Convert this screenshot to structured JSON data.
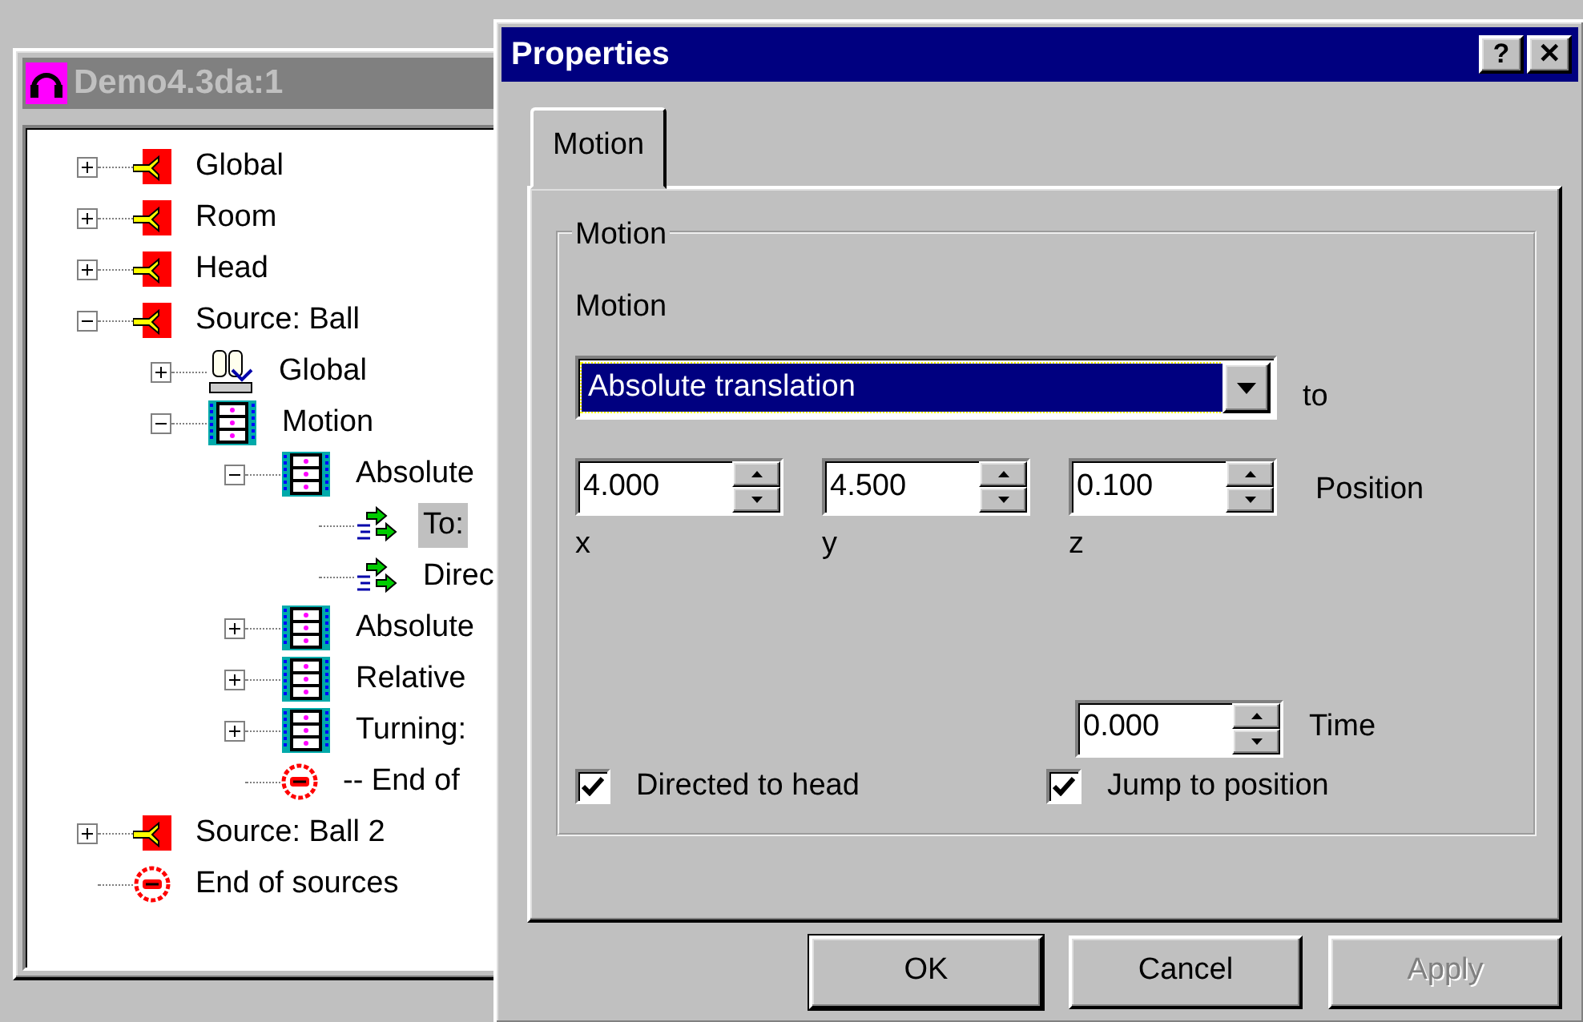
{
  "tree_window": {
    "title": "Demo4.3da:1",
    "items": [
      {
        "label": "Global",
        "kind": "source",
        "expanded": false,
        "selected": false
      },
      {
        "label": "Room",
        "kind": "source",
        "expanded": false,
        "selected": false
      },
      {
        "label": "Head",
        "kind": "source",
        "expanded": false,
        "selected": false
      },
      {
        "label": "Source: Ball",
        "kind": "source",
        "expanded": true,
        "selected": false,
        "children": [
          {
            "label": "Global",
            "kind": "global",
            "expanded": false,
            "selected": false
          },
          {
            "label": "Motion",
            "kind": "motion",
            "expanded": true,
            "selected": false,
            "children": [
              {
                "label": "Absolute",
                "kind": "motion",
                "expanded": true,
                "selected": false,
                "children": [
                  {
                    "label": "To:",
                    "kind": "action",
                    "selected": true
                  },
                  {
                    "label": "Direc",
                    "kind": "action",
                    "selected": false
                  }
                ]
              },
              {
                "label": "Absolute",
                "kind": "motion",
                "expanded": false,
                "selected": false
              },
              {
                "label": "Relative",
                "kind": "motion",
                "expanded": false,
                "selected": false
              },
              {
                "label": "Turning:",
                "kind": "motion",
                "expanded": false,
                "selected": false
              },
              {
                "label": "-- End of",
                "kind": "end",
                "selected": false
              }
            ]
          }
        ]
      },
      {
        "label": "Source: Ball 2",
        "kind": "source",
        "expanded": false,
        "selected": false
      },
      {
        "label": "End of sources",
        "kind": "end",
        "selected": false
      }
    ]
  },
  "dialog": {
    "title": "Properties",
    "title_buttons": [
      "?",
      "✕"
    ],
    "tabs": [
      {
        "label": "Motion",
        "selected": true
      }
    ],
    "group": {
      "title": "Motion",
      "motion_label": "Motion",
      "motion_value": "Absolute translation",
      "to_label": "to",
      "position_fields": [
        {
          "value": "4.000",
          "label": "x"
        },
        {
          "value": "4.500",
          "label": "y"
        },
        {
          "value": "0.100",
          "label": "z"
        }
      ],
      "position_label": "Position",
      "time_value": "0.000",
      "time_label": "Time",
      "checkboxes": [
        {
          "label": "Directed to head",
          "checked": true
        },
        {
          "label": "Jump to position",
          "checked": true
        }
      ]
    },
    "buttons": [
      {
        "label": "OK",
        "default": true,
        "disabled": false
      },
      {
        "label": "Cancel",
        "default": false,
        "disabled": false
      },
      {
        "label": "Apply",
        "default": false,
        "disabled": true
      }
    ]
  }
}
